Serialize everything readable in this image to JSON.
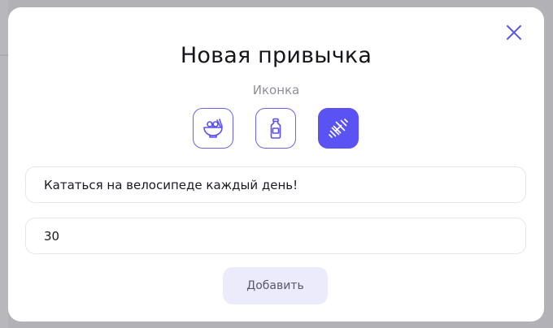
{
  "modal": {
    "title": "Новая привычка",
    "icon_section_label": "Иконка",
    "icons": [
      {
        "name": "noodle-bowl-icon",
        "selected": false
      },
      {
        "name": "water-bottle-icon",
        "selected": false
      },
      {
        "name": "dumbbell-icon",
        "selected": true
      }
    ],
    "habit_name_value": "Кататься на велосипеде каждый день!",
    "count_value": "30",
    "submit_label": "Добавить",
    "close_icon": "close-icon"
  },
  "colors": {
    "accent": "#5a52f2",
    "accent_light": "#ecebfc",
    "title_text": "#15151a",
    "muted_text": "#8e8e97"
  }
}
